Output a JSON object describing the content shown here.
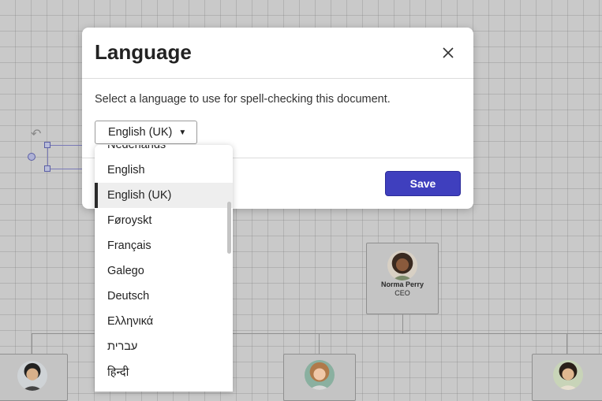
{
  "dialog": {
    "title": "Language",
    "description": "Select a language to use for spell-checking this document.",
    "selected_language": "English (UK)",
    "save_label": "Save"
  },
  "language_options": [
    "Nederlands",
    "English",
    "English (UK)",
    "Føroyskt",
    "Français",
    "Galego",
    "Deutsch",
    "Ελληνικά",
    "עברית",
    "हिन्दी"
  ],
  "selected_index": 2,
  "org_chart": {
    "ceo": {
      "name": "Norma Perry",
      "role": "CEO"
    }
  },
  "colors": {
    "accent": "#3f3fbe",
    "selection_bar": "#2a2a2a",
    "canvas_bg": "#c9c9c9"
  },
  "icons": {
    "close": "close-icon",
    "dropdown_caret": "caret-down-icon",
    "rotate": "rotate-icon"
  }
}
